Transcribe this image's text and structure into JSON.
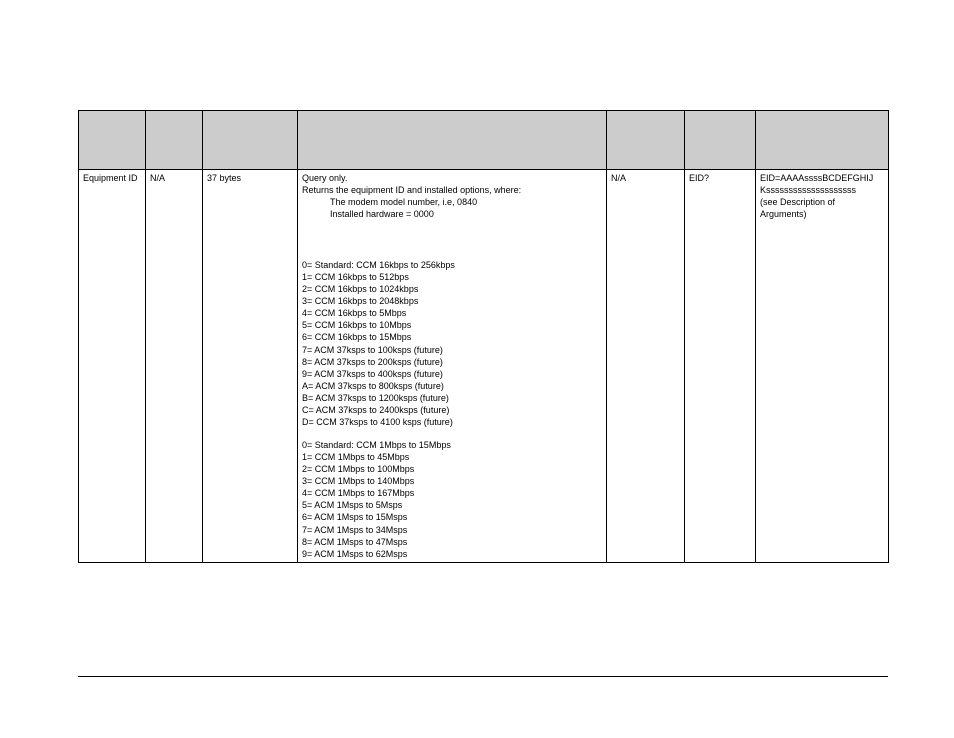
{
  "table": {
    "row": {
      "col1": "Equipment ID",
      "col2": "N/A",
      "col3": "37 bytes",
      "col5": "N/A",
      "col6": "EID?",
      "col7_lines": [
        "EID=AAAAssssBCDEFGHIJ",
        "Kssssssssssssssssssss",
        "(see Description of",
        "Arguments)"
      ],
      "desc_top": [
        "Query only.",
        "Returns the equipment ID and installed options,  where:"
      ],
      "desc_indent": [
        "The modem model number, i.e, 0840",
        "Installed hardware = 0000"
      ],
      "desc_block1": [
        "0= Standard: CCM 16kbps to 256kbps",
        "1= CCM 16kbps to  512bps",
        "2= CCM 16kbps to 1024kbps",
        "3= CCM 16kbps to 2048kbps",
        "4= CCM 16kbps to 5Mbps",
        "5= CCM 16kbps to 10Mbps",
        "6= CCM 16kbps to 15Mbps",
        "7= ACM 37ksps to 100ksps    (future)",
        "8= ACM 37ksps to 200ksps    (future)",
        "9= ACM 37ksps to 400ksps   (future)",
        "A= ACM 37ksps to 800ksps   (future)",
        "B= ACM 37ksps to 1200ksps  (future)",
        "C= ACM 37ksps to 2400ksps  (future)",
        "D= CCM 37ksps to 4100 ksps  (future)"
      ],
      "desc_block2": [
        "0= Standard:  CCM 1Mbps to 15Mbps",
        "1= CCM 1Mbps to 45Mbps",
        "2= CCM 1Mbps to 100Mbps",
        "3= CCM 1Mbps to 140Mbps",
        "4= CCM 1Mbps to 167Mbps",
        "5= ACM 1Msps to 5Msps",
        "6= ACM 1Msps to 15Msps",
        "7= ACM 1Msps to 34Msps",
        "8= ACM 1Msps to 47Msps",
        "9= ACM 1Msps to 62Msps"
      ]
    }
  }
}
